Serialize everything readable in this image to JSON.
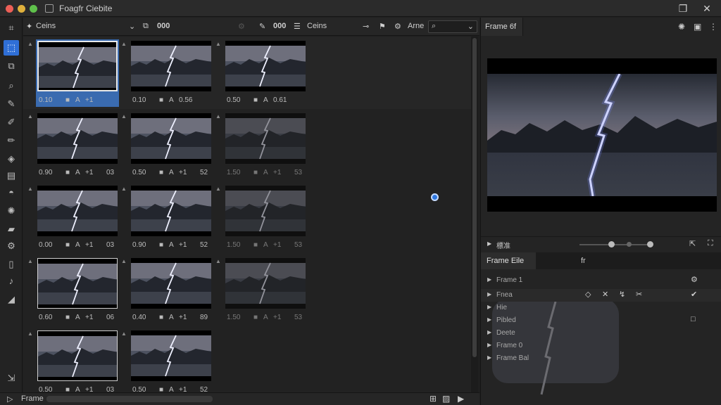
{
  "window": {
    "title": "Foagfr Ciebite"
  },
  "toolbar": {
    "left_label": "Ceins",
    "count_a": "000",
    "count_b": "000",
    "right_label": "Ceins",
    "search_label": "Arne"
  },
  "thumbnails": [
    [
      {
        "a": "0.10",
        "b": "■",
        "c": "A",
        "d": "+1",
        "e": ""
      },
      {
        "a": "0.10",
        "b": "■",
        "c": "A",
        "d": "0.56",
        "e": ""
      },
      {
        "a": "0.50",
        "b": "■",
        "c": "A",
        "d": "0.61",
        "e": ""
      }
    ],
    [
      {
        "a": "0.90",
        "b": "■",
        "c": "A",
        "d": "+1",
        "e": "03"
      },
      {
        "a": "0.50",
        "b": "■",
        "c": "A",
        "d": "+1",
        "e": "52"
      },
      {
        "a": "1.50",
        "b": "■",
        "c": "A",
        "d": "+1",
        "e": "53"
      }
    ],
    [
      {
        "a": "0.00",
        "b": "■",
        "c": "A",
        "d": "+1",
        "e": "03"
      },
      {
        "a": "0.90",
        "b": "■",
        "c": "A",
        "d": "+1",
        "e": "52"
      },
      {
        "a": "1.50",
        "b": "■",
        "c": "A",
        "d": "+1",
        "e": "53"
      }
    ],
    [
      {
        "a": "0.60",
        "b": "■",
        "c": "A",
        "d": "+1",
        "e": "06"
      },
      {
        "a": "0.40",
        "b": "■",
        "c": "A",
        "d": "+1",
        "e": "89"
      },
      {
        "a": "1.50",
        "b": "■",
        "c": "A",
        "d": "+1",
        "e": "53"
      }
    ],
    [
      {
        "a": "0.50",
        "b": "■",
        "c": "A",
        "d": "+1",
        "e": "03"
      },
      {
        "a": "0.50",
        "b": "■",
        "c": "A",
        "d": "+1",
        "e": "52"
      }
    ]
  ],
  "inspector": {
    "tab": "Frame 6f",
    "slider_label": "標准",
    "section_tab": "Frame Eile",
    "section_value": "fr",
    "props": [
      "Frame 1",
      "Fnea",
      "Hie",
      "Pibled",
      "Deete",
      "Frame 0",
      "Frame Bal"
    ]
  },
  "bottom": {
    "label": "Frame"
  },
  "colors": {
    "accent": "#2f6fd6",
    "selection": "#3a6bb0",
    "background": "#1f1f1f"
  }
}
